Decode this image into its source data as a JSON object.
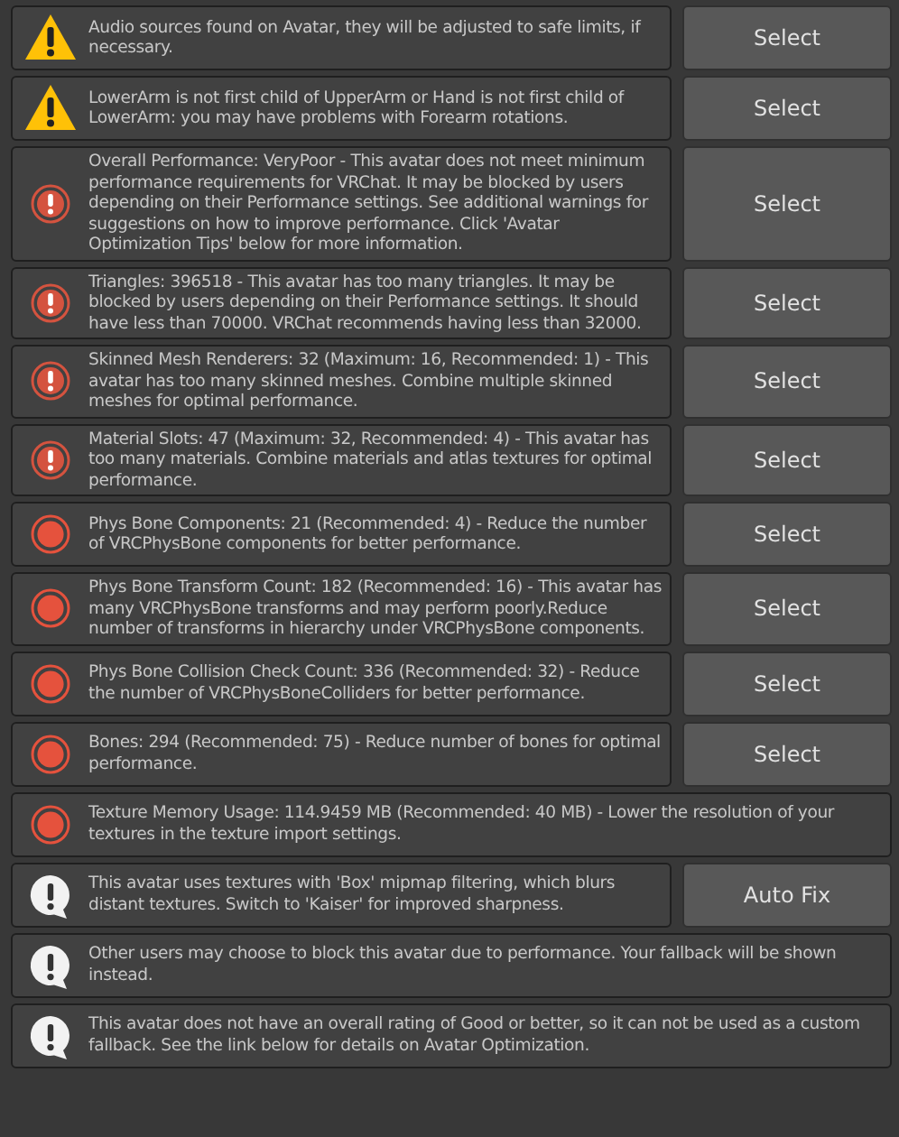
{
  "messages": [
    {
      "kind": "warning",
      "text": "Audio sources found on Avatar, they will be adjusted to safe limits, if necessary.",
      "button": "Select"
    },
    {
      "kind": "warning",
      "text": "LowerArm is not first child of UpperArm or Hand is not first child of LowerArm: you may have problems with Forearm rotations.",
      "button": "Select"
    },
    {
      "kind": "error",
      "text": "Overall Performance: VeryPoor - This avatar does not meet minimum performance requirements for VRChat. It may be blocked by users depending on their Performance settings. See additional warnings for suggestions on how to improve performance. Click 'Avatar Optimization Tips' below for more information.",
      "button": "Select"
    },
    {
      "kind": "error",
      "text": "Triangles: 396518 - This avatar has too many triangles. It may be blocked by users depending on their Performance settings. It should have less than 70000. VRChat recommends having less than 32000.",
      "button": "Select"
    },
    {
      "kind": "error",
      "text": "Skinned Mesh Renderers: 32 (Maximum: 16, Recommended: 1) - This avatar has too many skinned meshes. Combine multiple skinned meshes for optimal performance.",
      "button": "Select"
    },
    {
      "kind": "error",
      "text": "Material Slots: 47 (Maximum: 32, Recommended: 4) - This avatar has too many materials. Combine materials and atlas textures for optimal performance.",
      "button": "Select"
    },
    {
      "kind": "poor",
      "text": "Phys Bone Components: 21 (Recommended: 4) - Reduce the number of VRCPhysBone components for better performance.",
      "button": "Select"
    },
    {
      "kind": "poor",
      "text": "Phys Bone Transform Count: 182 (Recommended: 16) - This avatar has many VRCPhysBone transforms and may perform poorly.Reduce number of transforms in hierarchy under VRCPhysBone components.",
      "button": "Select"
    },
    {
      "kind": "poor",
      "text": "Phys Bone Collision Check Count: 336 (Recommended: 32) - Reduce the number of VRCPhysBoneColliders for better performance.",
      "button": "Select"
    },
    {
      "kind": "poor",
      "text": "Bones: 294 (Recommended: 75) - Reduce number of bones for optimal performance.",
      "button": "Select"
    },
    {
      "kind": "poor",
      "text": "Texture Memory Usage: 114.9459 MB (Recommended: 40 MB) - Lower the resolution of your textures in the texture import settings."
    },
    {
      "kind": "info",
      "text": "This avatar uses textures with 'Box' mipmap filtering, which blurs distant textures. Switch to 'Kaiser' for improved sharpness.",
      "button": "Auto Fix"
    },
    {
      "kind": "info",
      "text": "Other users may choose to block this avatar due to performance. Your fallback will be shown instead."
    },
    {
      "kind": "info",
      "text": "This avatar does not have an overall rating of Good or better, so it can not be used as a custom fallback. See the link below for details on Avatar Optimization."
    }
  ]
}
